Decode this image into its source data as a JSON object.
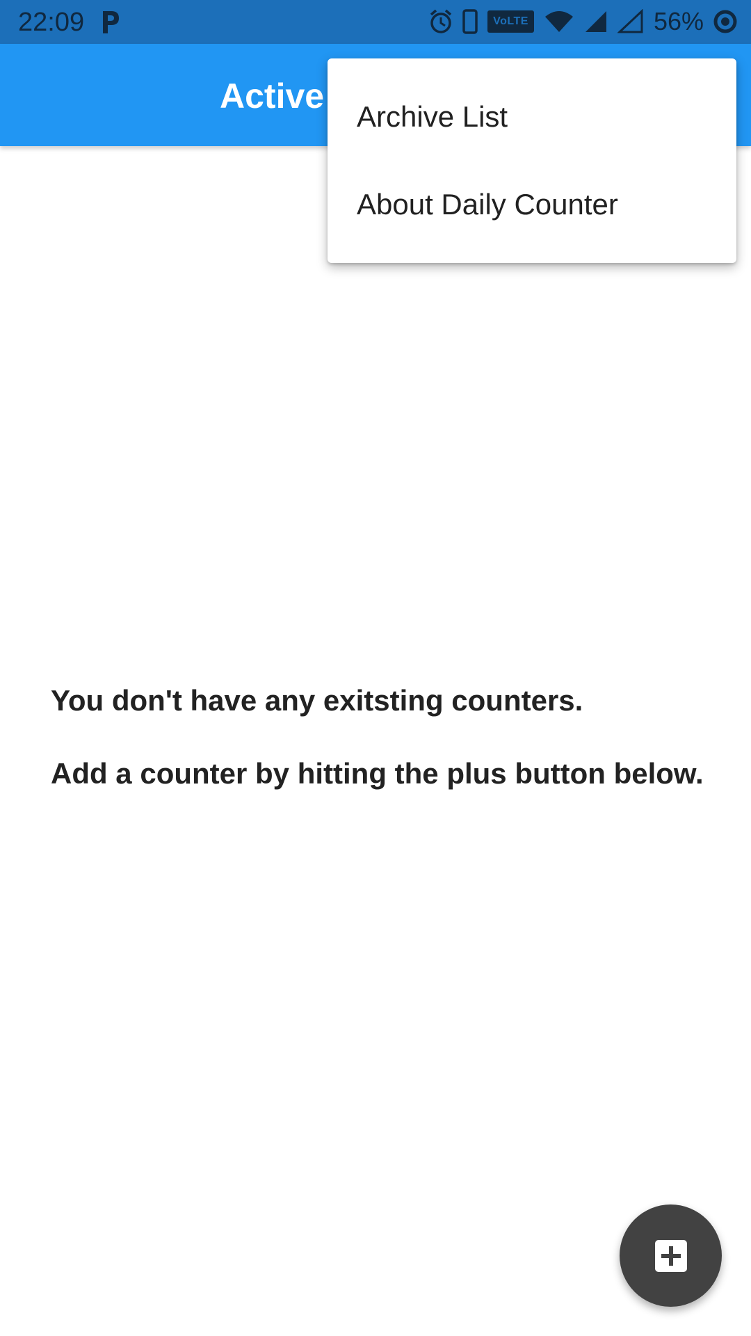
{
  "status_bar": {
    "time": "22:09",
    "network_badge": "VoLTE",
    "battery": "56%",
    "icons": [
      "parking-app-icon",
      "alarm-icon",
      "phone-icon",
      "volte-icon",
      "wifi-icon",
      "signal-icon",
      "signal-empty-icon",
      "battery-saver-icon"
    ]
  },
  "app_bar": {
    "title": "Active",
    "background_color": "#2196f3"
  },
  "menu": {
    "items": [
      {
        "label": "Archive List"
      },
      {
        "label": "About Daily Counter"
      }
    ]
  },
  "empty_state": {
    "line1": "You don't have any exitsting counters.",
    "line2": "Add a counter by hitting the plus button below."
  },
  "fab": {
    "icon": "add-box-icon",
    "color": "#424242"
  }
}
